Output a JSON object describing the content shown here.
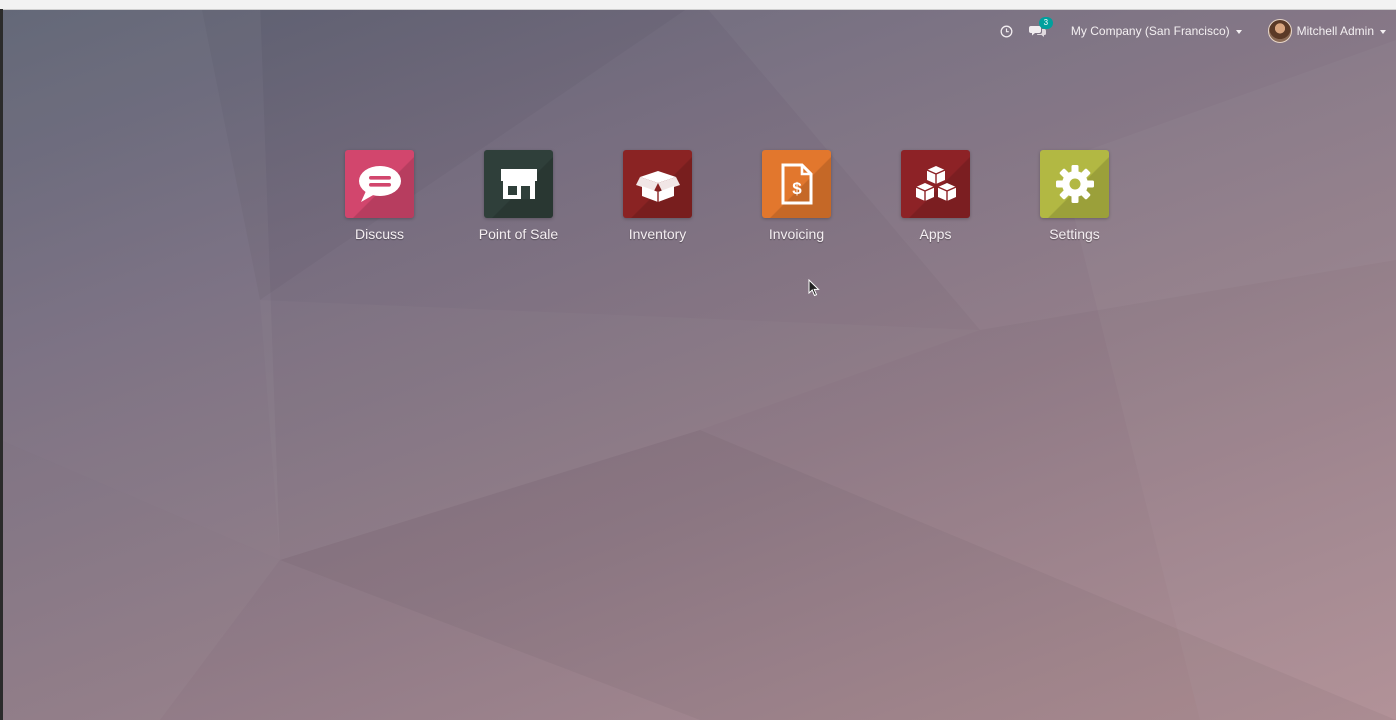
{
  "systray": {
    "chat_badge": "3",
    "company": "My Company (San Francisco)",
    "user": "Mitchell Admin"
  },
  "apps": [
    {
      "label": "Discuss",
      "color": "#d2466d",
      "icon": "chat-bubble-icon"
    },
    {
      "label": "Point of Sale",
      "color": "#2f3f3a",
      "icon": "store-icon"
    },
    {
      "label": "Inventory",
      "color": "#8a2323",
      "icon": "box-icon"
    },
    {
      "label": "Invoicing",
      "color": "#e2772d",
      "icon": "invoice-icon"
    },
    {
      "label": "Apps",
      "color": "#8d2226",
      "icon": "cubes-icon"
    },
    {
      "label": "Settings",
      "color": "#b2b843",
      "icon": "gear-icon"
    }
  ],
  "colors": {
    "badge": "#00a09d",
    "text": "#f5eff2"
  }
}
